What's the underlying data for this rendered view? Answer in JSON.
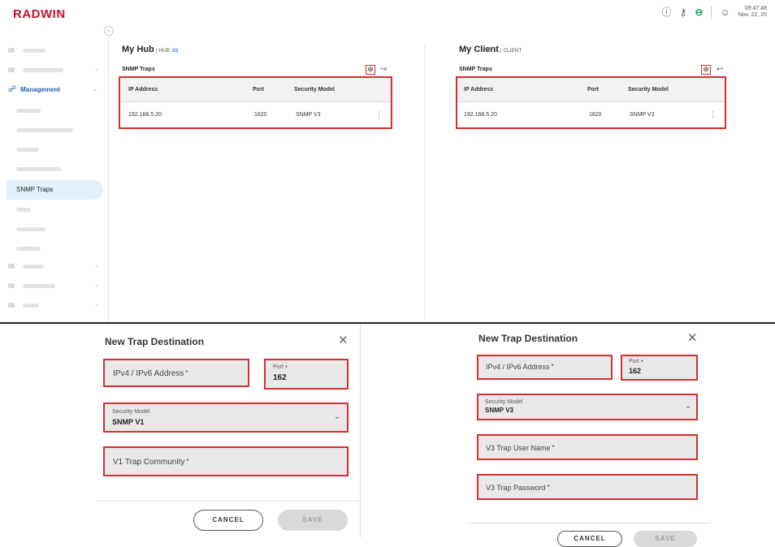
{
  "app": {
    "logo": "RADWIN",
    "time": "09:47:48",
    "date": "Nov. 22, 20",
    "icons": [
      "info-icon",
      "key-icon",
      "link-icon",
      "user-icon"
    ]
  },
  "sidebar": {
    "management_label": "Management",
    "active_item": "SNMP Traps"
  },
  "hub": {
    "title": "My Hub",
    "subtitle": "HUB",
    "section": "SNMP Traps",
    "columns": [
      "IP Address",
      "Port",
      "Security Model"
    ],
    "rows": [
      {
        "ip": "192.168.5.20",
        "port": "1620",
        "model": "SNMP V3"
      }
    ]
  },
  "client": {
    "title": "My Client",
    "subtitle": "CLIENT",
    "section": "SNMP Traps",
    "columns": [
      "IP Address",
      "Port",
      "Security Model"
    ],
    "rows": [
      {
        "ip": "192.168.5.20",
        "port": "1620",
        "model": "SNMP V3"
      }
    ]
  },
  "dialog_v1": {
    "title": "New Trap Destination",
    "address_label": "IPv4 / IPv6 Address",
    "port_label": "Port",
    "port_value": "162",
    "security_label": "Security Model",
    "security_value": "SNMP V1",
    "community_label": "V1 Trap Community",
    "cancel": "CANCEL",
    "save": "SAVE"
  },
  "dialog_v3": {
    "title": "New Trap Destination",
    "address_label": "IPv4 / IPv6 Address",
    "port_label": "Port",
    "port_value": "162",
    "security_label": "Security Model",
    "security_value": "SNMP V3",
    "user_label": "V3 Trap User Name",
    "password_label": "V3 Trap Password",
    "cancel": "CANCEL",
    "save": "SAVE"
  },
  "colors": {
    "brand": "#c8102e",
    "highlight": "#d32f2f",
    "active_nav": "#e3f1fb",
    "nav_blue": "#1f5fa8"
  }
}
